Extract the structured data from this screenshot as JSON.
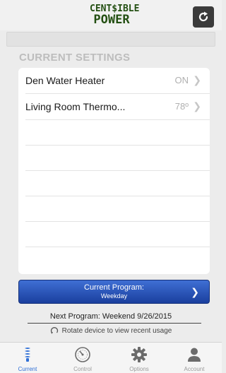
{
  "header": {
    "logo_line1": "CENT$IBLE",
    "logo_line2": "POWER",
    "refresh_icon": "refresh-icon"
  },
  "section_title": "CURRENT SETTINGS",
  "settings": [
    {
      "label": "Den Water Heater",
      "value": "ON"
    },
    {
      "label": "Living Room Thermo...",
      "value": "78º"
    }
  ],
  "program": {
    "title": "Current Program:",
    "name": "Weekday"
  },
  "next_program": "Next Program: Weekend 9/26/2015",
  "rotate_hint": "Rotate device to view recent usage",
  "tabs": [
    {
      "label": "Current",
      "icon": "bulb-icon",
      "active": true
    },
    {
      "label": "Control",
      "icon": "gauge-icon",
      "active": false
    },
    {
      "label": "Options",
      "icon": "gear-icon",
      "active": false
    },
    {
      "label": "Account",
      "icon": "user-icon",
      "active": false
    }
  ],
  "colors": {
    "accent": "#2f6fd6",
    "program_button": "#1a3f9e",
    "logo_green": "#234f12"
  }
}
